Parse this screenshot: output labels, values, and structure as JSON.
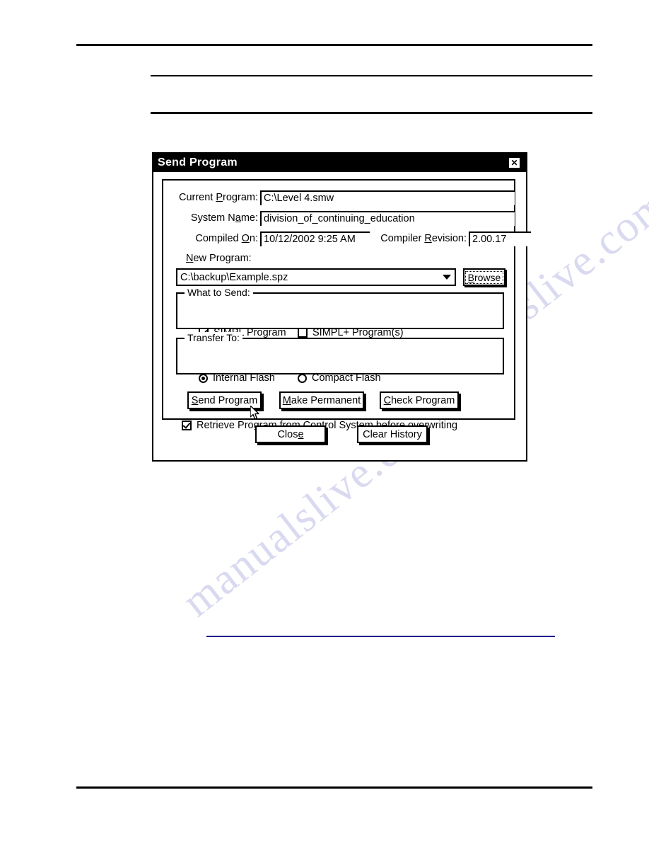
{
  "page": {
    "rules": {
      "top_main": "",
      "sub_upper": "",
      "sub_lower": "",
      "bottom": "",
      "accent_color": "#1a1a8c"
    },
    "watermark_text": "manualslive.com"
  },
  "dialog": {
    "title": "Send Program",
    "close_glyph": "✕",
    "fields": {
      "current_program": {
        "label_before": "Current ",
        "label_accel": "P",
        "label_after": "rogram:",
        "value": "C:\\Level 4.smw"
      },
      "system_name": {
        "label_before": "System N",
        "label_accel": "a",
        "label_after": "me:",
        "value": "division_of_continuing_education"
      },
      "compiled_on": {
        "label_before": "Compiled ",
        "label_accel": "O",
        "label_after": "n:",
        "value": "10/12/2002 9:25 AM"
      },
      "compiler_revision": {
        "label_before": "Compiler ",
        "label_accel": "R",
        "label_after": "evision:",
        "value": "2.00.17"
      }
    },
    "new_program": {
      "label_accel": "N",
      "label_after": "ew Program:",
      "combo_value": "C:\\backup\\Example.spz",
      "combo_arrow_icon": "chevron-down-icon",
      "browse_label_accel": "B",
      "browse_label_after": "rowse"
    },
    "what_to_send": {
      "group_title": "What to Send:",
      "options": [
        {
          "label": "SIMPL Program",
          "checked": true
        },
        {
          "label": "SIMPL+ Program(s)",
          "checked": false
        }
      ]
    },
    "transfer_to": {
      "group_title": "Transfer To:",
      "options": [
        {
          "label": "Internal Flash",
          "selected": true
        },
        {
          "label": "Compact Flash",
          "selected": false
        }
      ]
    },
    "action_buttons": [
      {
        "accel": "S",
        "rest": "end Program"
      },
      {
        "accel": "M",
        "rest": "ake Permanent"
      },
      {
        "accel": "C",
        "rest": "heck Program"
      }
    ],
    "retrieve_option": {
      "label": "Retrieve Program from Control System before overwriting",
      "checked": true
    },
    "bottom_buttons": [
      {
        "before": "Clos",
        "accel": "e",
        "after": ""
      },
      {
        "before": "Clear History",
        "accel": "",
        "after": ""
      }
    ]
  }
}
